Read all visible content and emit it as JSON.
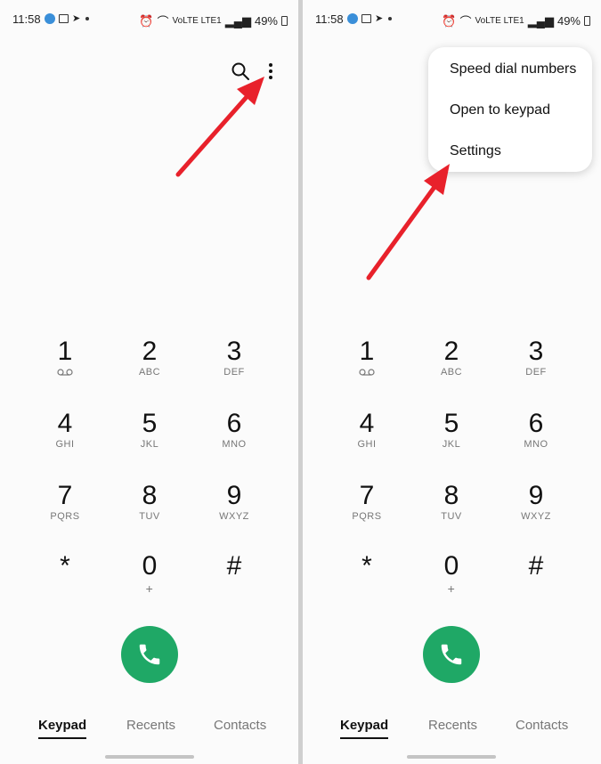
{
  "status_bar": {
    "time": "11:58",
    "network": "VoLTE LTE1",
    "battery": "49%"
  },
  "menu": {
    "items": [
      {
        "label": "Speed dial numbers"
      },
      {
        "label": "Open to keypad"
      },
      {
        "label": "Settings"
      }
    ]
  },
  "keypad": {
    "keys": [
      {
        "digit": "1",
        "letters": ""
      },
      {
        "digit": "2",
        "letters": "ABC"
      },
      {
        "digit": "3",
        "letters": "DEF"
      },
      {
        "digit": "4",
        "letters": "GHI"
      },
      {
        "digit": "5",
        "letters": "JKL"
      },
      {
        "digit": "6",
        "letters": "MNO"
      },
      {
        "digit": "7",
        "letters": "PQRS"
      },
      {
        "digit": "8",
        "letters": "TUV"
      },
      {
        "digit": "9",
        "letters": "WXYZ"
      },
      {
        "digit": "*",
        "letters": ""
      },
      {
        "digit": "0",
        "letters": "+"
      },
      {
        "digit": "#",
        "letters": ""
      }
    ]
  },
  "tabs": [
    {
      "label": "Keypad",
      "active": true
    },
    {
      "label": "Recents",
      "active": false
    },
    {
      "label": "Contacts",
      "active": false
    }
  ],
  "icons": {
    "search": "search-icon",
    "more": "more-vertical-icon",
    "call": "phone-icon",
    "voicemail": "voicemail-icon"
  },
  "colors": {
    "call_button": "#1fa866",
    "annotation_arrow": "#e8212b",
    "background": "#fbfbfb"
  }
}
